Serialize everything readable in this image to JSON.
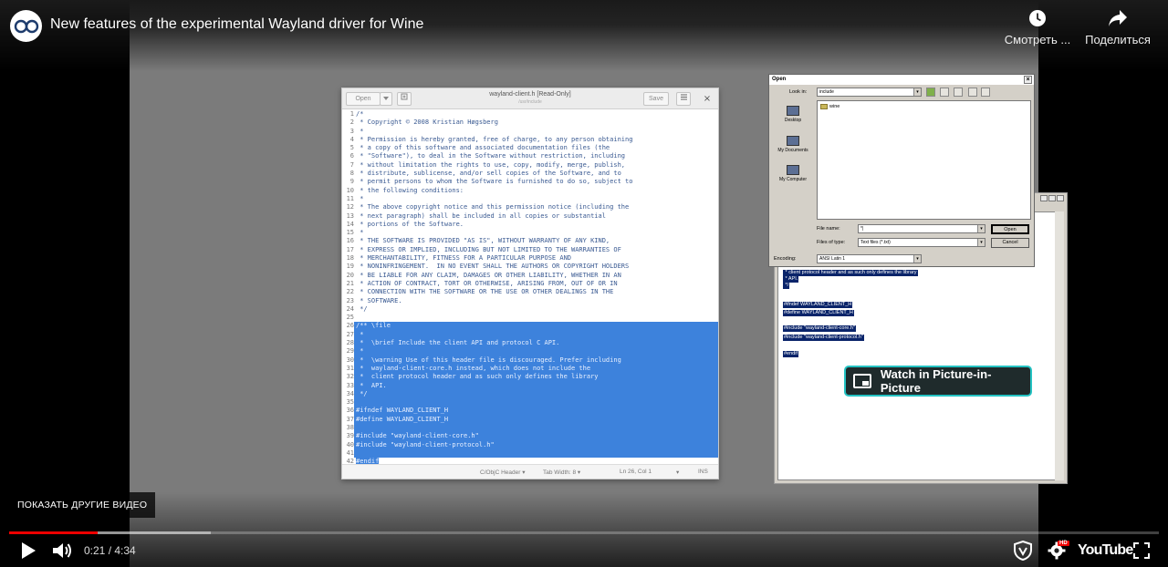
{
  "video": {
    "title": "New features of the experimental Wayland driver for Wine"
  },
  "top_actions": {
    "watch_later": "Смотреть ...",
    "share": "Поделиться"
  },
  "gedit": {
    "open_label": "Open",
    "save_label": "Save",
    "close_glyph": "×",
    "title": "wayland-client.h [Read-Only]",
    "subtitle": "/usr/include",
    "status": {
      "language": "C/ObjC Header ▾",
      "tab_width": "Tab Width: 8 ▾",
      "position": "Ln 26, Col 1",
      "mode": "INS"
    },
    "lines": [
      {
        "n": "1",
        "t": "/*",
        "sel": false
      },
      {
        "n": "2",
        "t": " * Copyright © 2008 Kristian Høgsberg",
        "sel": false
      },
      {
        "n": "3",
        "t": " *",
        "sel": false
      },
      {
        "n": "4",
        "t": " * Permission is hereby granted, free of charge, to any person obtaining",
        "sel": false
      },
      {
        "n": "5",
        "t": " * a copy of this software and associated documentation files (the",
        "sel": false
      },
      {
        "n": "6",
        "t": " * \"Software\"), to deal in the Software without restriction, including",
        "sel": false
      },
      {
        "n": "7",
        "t": " * without limitation the rights to use, copy, modify, merge, publish,",
        "sel": false
      },
      {
        "n": "8",
        "t": " * distribute, sublicense, and/or sell copies of the Software, and to",
        "sel": false
      },
      {
        "n": "9",
        "t": " * permit persons to whom the Software is furnished to do so, subject to",
        "sel": false
      },
      {
        "n": "10",
        "t": " * the following conditions:",
        "sel": false
      },
      {
        "n": "11",
        "t": " *",
        "sel": false
      },
      {
        "n": "12",
        "t": " * The above copyright notice and this permission notice (including the",
        "sel": false
      },
      {
        "n": "13",
        "t": " * next paragraph) shall be included in all copies or substantial",
        "sel": false
      },
      {
        "n": "14",
        "t": " * portions of the Software.",
        "sel": false
      },
      {
        "n": "15",
        "t": " *",
        "sel": false
      },
      {
        "n": "16",
        "t": " * THE SOFTWARE IS PROVIDED \"AS IS\", WITHOUT WARRANTY OF ANY KIND,",
        "sel": false
      },
      {
        "n": "17",
        "t": " * EXPRESS OR IMPLIED, INCLUDING BUT NOT LIMITED TO THE WARRANTIES OF",
        "sel": false
      },
      {
        "n": "18",
        "t": " * MERCHANTABILITY, FITNESS FOR A PARTICULAR PURPOSE AND",
        "sel": false
      },
      {
        "n": "19",
        "t": " * NONINFRINGEMENT.  IN NO EVENT SHALL THE AUTHORS OR COPYRIGHT HOLDERS",
        "sel": false
      },
      {
        "n": "20",
        "t": " * BE LIABLE FOR ANY CLAIM, DAMAGES OR OTHER LIABILITY, WHETHER IN AN",
        "sel": false
      },
      {
        "n": "21",
        "t": " * ACTION OF CONTRACT, TORT OR OTHERWISE, ARISING FROM, OUT OF OR IN",
        "sel": false
      },
      {
        "n": "22",
        "t": " * CONNECTION WITH THE SOFTWARE OR THE USE OR OTHER DEALINGS IN THE",
        "sel": false
      },
      {
        "n": "23",
        "t": " * SOFTWARE.",
        "sel": false
      },
      {
        "n": "24",
        "t": " */",
        "sel": false
      },
      {
        "n": "25",
        "t": "",
        "sel": false
      },
      {
        "n": "26",
        "t": "/** \\file",
        "sel": true
      },
      {
        "n": "27",
        "t": " *",
        "sel": true
      },
      {
        "n": "28",
        "t": " *  \\brief Include the client API and protocol C API.",
        "sel": true
      },
      {
        "n": "29",
        "t": " *",
        "sel": true
      },
      {
        "n": "30",
        "t": " *  \\warning Use of this header file is discouraged. Prefer including",
        "sel": true
      },
      {
        "n": "31",
        "t": " *  wayland-client-core.h instead, which does not include the",
        "sel": true
      },
      {
        "n": "32",
        "t": " *  client protocol header and as such only defines the library",
        "sel": true
      },
      {
        "n": "33",
        "t": " *  API.",
        "sel": true
      },
      {
        "n": "34",
        "t": " */",
        "sel": true
      },
      {
        "n": "35",
        "t": "",
        "sel": true
      },
      {
        "n": "36",
        "t": "#ifndef WAYLAND_CLIENT_H",
        "sel": true
      },
      {
        "n": "37",
        "t": "#define WAYLAND_CLIENT_H",
        "sel": true
      },
      {
        "n": "38",
        "t": "",
        "sel": true
      },
      {
        "n": "39",
        "t": "#include \"wayland-client-core.h\"",
        "sel": true
      },
      {
        "n": "40",
        "t": "#include \"wayland-client-protocol.h\"",
        "sel": true
      },
      {
        "n": "41",
        "t": "",
        "sel": true
      },
      {
        "n": "42",
        "t": "#endif",
        "sel": "partial"
      }
    ]
  },
  "notepad": {
    "lines": [
      " * client protocol header and as such only defines the library",
      " * API.",
      " */",
      "",
      "#ifndef WAYLAND_CLIENT_H",
      "#define WAYLAND_CLIENT_H",
      "",
      "#include \"wayland-client-core.h\"",
      "#include \"wayland-client-protocol.h\"",
      "",
      "#endif"
    ]
  },
  "open_dialog": {
    "title": "Open",
    "look_in_label": "Look in:",
    "look_in_value": "include",
    "places": [
      "Desktop",
      "My Documents",
      "My Computer"
    ],
    "files": [
      "wine"
    ],
    "file_name_label": "File name:",
    "file_name_value": "*|",
    "files_of_type_label": "Files of type:",
    "files_of_type_value": "Text files (*.txt)",
    "encoding_label": "Encoding:",
    "encoding_value": "ANSI Latin 1",
    "open_button": "Open",
    "cancel_button": "Cancel"
  },
  "pip": {
    "label": "Watch in Picture-in-Picture"
  },
  "more_videos": "ПОКАЗАТЬ ДРУГИЕ ВИДЕО",
  "player": {
    "time_current": "0:21",
    "time_total": "4:34",
    "time_display": "0:21 / 4:34",
    "progress_fraction": 0.0766,
    "buffer_fraction": 0.175,
    "logo_text": "YouTube",
    "hd_badge": "HD",
    "colors": {
      "progress": "#ee0000",
      "pip_border": "#24c3c3"
    }
  }
}
